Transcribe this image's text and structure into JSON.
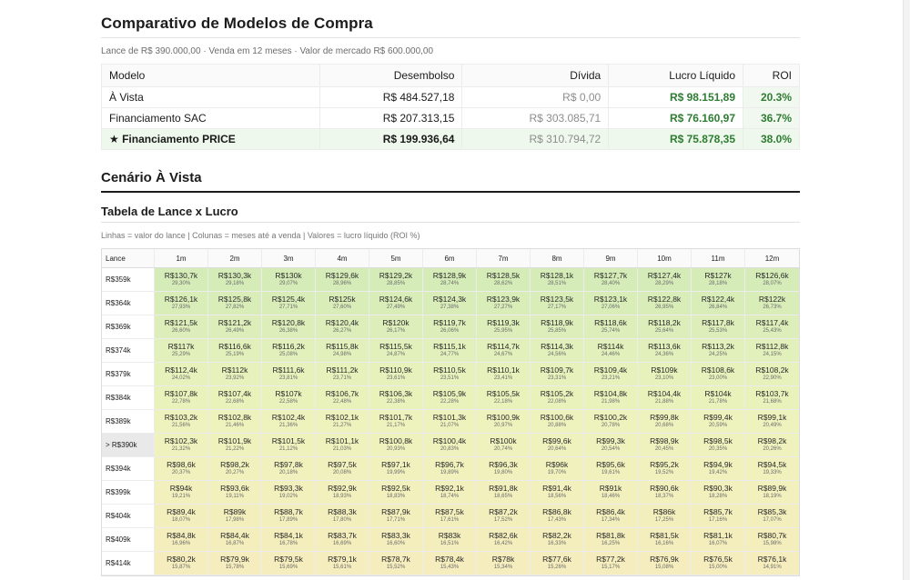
{
  "header": {
    "title": "Comparativo de Modelos de Compra",
    "subtitle": "Lance de R$ 390.000,00 · Venda em 12 meses · Valor de mercado R$ 600.000,00"
  },
  "comparison": {
    "columns": [
      "Modelo",
      "Desembolso",
      "Dívida",
      "Lucro Líquido",
      "ROI"
    ],
    "rows": [
      {
        "modelo": "À Vista",
        "desembolso": "R$ 484.527,18",
        "divida": "R$ 0,00",
        "lucro": "R$ 98.151,89",
        "roi": "20.3%"
      },
      {
        "modelo": "Financiamento SAC",
        "desembolso": "R$ 207.313,15",
        "divida": "R$ 303.085,71",
        "lucro": "R$ 76.160,97",
        "roi": "36.7%"
      },
      {
        "modelo": "★ Financiamento PRICE",
        "desembolso": "R$ 199.936,64",
        "divida": "R$ 310.794,72",
        "lucro": "R$ 75.878,35",
        "roi": "38.0%"
      }
    ]
  },
  "scenario": {
    "title": "Cenário À Vista",
    "table_title": "Tabela de Lance x Lucro",
    "legend": "Linhas = valor do lance | Colunas = meses até a venda | Valores = lucro líquido (ROI %)",
    "corner_label": "Lance",
    "months": [
      "1m",
      "2m",
      "3m",
      "4m",
      "5m",
      "6m",
      "7m",
      "8m",
      "9m",
      "10m",
      "11m",
      "12m"
    ],
    "colors": {
      "high": "#d5ecb8",
      "mid": "#eef3bd",
      "low": "#f5edbd"
    },
    "rows": [
      {
        "lance": "R$359k",
        "selected": false,
        "values": [
          "R$130,7k",
          "R$130,3k",
          "R$130k",
          "R$129,6k",
          "R$129,2k",
          "R$128,9k",
          "R$128,5k",
          "R$128,1k",
          "R$127,7k",
          "R$127,4k",
          "R$127k",
          "R$126,6k"
        ],
        "roi": [
          "29,30%",
          "29,18%",
          "29,07%",
          "28,96%",
          "28,85%",
          "28,74%",
          "28,62%",
          "28,51%",
          "28,40%",
          "28,29%",
          "28,18%",
          "28,07%"
        ]
      },
      {
        "lance": "R$364k",
        "selected": false,
        "values": [
          "R$126,1k",
          "R$125,8k",
          "R$125,4k",
          "R$125k",
          "R$124,6k",
          "R$124,3k",
          "R$123,9k",
          "R$123,5k",
          "R$123,1k",
          "R$122,8k",
          "R$122,4k",
          "R$122k"
        ],
        "roi": [
          "27,93%",
          "27,82%",
          "27,71%",
          "27,60%",
          "27,49%",
          "27,38%",
          "27,27%",
          "27,17%",
          "27,06%",
          "26,95%",
          "26,84%",
          "26,73%"
        ]
      },
      {
        "lance": "R$369k",
        "selected": false,
        "values": [
          "R$121,5k",
          "R$121,2k",
          "R$120,8k",
          "R$120,4k",
          "R$120k",
          "R$119,7k",
          "R$119,3k",
          "R$118,9k",
          "R$118,6k",
          "R$118,2k",
          "R$117,8k",
          "R$117,4k"
        ],
        "roi": [
          "26,60%",
          "26,49%",
          "26,38%",
          "26,27%",
          "26,17%",
          "26,06%",
          "25,95%",
          "25,85%",
          "25,74%",
          "25,64%",
          "25,53%",
          "25,43%"
        ]
      },
      {
        "lance": "R$374k",
        "selected": false,
        "values": [
          "R$117k",
          "R$116,6k",
          "R$116,2k",
          "R$115,8k",
          "R$115,5k",
          "R$115,1k",
          "R$114,7k",
          "R$114,3k",
          "R$114k",
          "R$113,6k",
          "R$113,2k",
          "R$112,8k"
        ],
        "roi": [
          "25,29%",
          "25,19%",
          "25,08%",
          "24,98%",
          "24,87%",
          "24,77%",
          "24,67%",
          "24,56%",
          "24,46%",
          "24,36%",
          "24,25%",
          "24,15%"
        ]
      },
      {
        "lance": "R$379k",
        "selected": false,
        "values": [
          "R$112,4k",
          "R$112k",
          "R$111,6k",
          "R$111,2k",
          "R$110,9k",
          "R$110,5k",
          "R$110,1k",
          "R$109,7k",
          "R$109,4k",
          "R$109k",
          "R$108,6k",
          "R$108,2k"
        ],
        "roi": [
          "24,02%",
          "23,92%",
          "23,81%",
          "23,71%",
          "23,61%",
          "23,51%",
          "23,41%",
          "23,31%",
          "23,21%",
          "23,10%",
          "23,00%",
          "22,90%"
        ]
      },
      {
        "lance": "R$384k",
        "selected": false,
        "values": [
          "R$107,8k",
          "R$107,4k",
          "R$107k",
          "R$106,7k",
          "R$106,3k",
          "R$105,9k",
          "R$105,5k",
          "R$105,2k",
          "R$104,8k",
          "R$104,4k",
          "R$104k",
          "R$103,7k"
        ],
        "roi": [
          "22,78%",
          "22,68%",
          "22,58%",
          "22,48%",
          "22,38%",
          "22,28%",
          "22,18%",
          "22,08%",
          "21,98%",
          "21,88%",
          "21,78%",
          "21,68%"
        ]
      },
      {
        "lance": "R$389k",
        "selected": false,
        "values": [
          "R$103,2k",
          "R$102,8k",
          "R$102,4k",
          "R$102,1k",
          "R$101,7k",
          "R$101,3k",
          "R$100,9k",
          "R$100,6k",
          "R$100,2k",
          "R$99,8k",
          "R$99,4k",
          "R$99,1k"
        ],
        "roi": [
          "21,56%",
          "21,46%",
          "21,36%",
          "21,27%",
          "21,17%",
          "21,07%",
          "20,97%",
          "20,88%",
          "20,78%",
          "20,68%",
          "20,59%",
          "20,49%"
        ]
      },
      {
        "lance": "> R$390k",
        "selected": true,
        "values": [
          "R$102,3k",
          "R$101,9k",
          "R$101,5k",
          "R$101,1k",
          "R$100,8k",
          "R$100,4k",
          "R$100k",
          "R$99,6k",
          "R$99,3k",
          "R$98,9k",
          "R$98,5k",
          "R$98,2k"
        ],
        "roi": [
          "21,32%",
          "21,22%",
          "21,12%",
          "21,03%",
          "20,93%",
          "20,83%",
          "20,74%",
          "20,64%",
          "20,54%",
          "20,45%",
          "20,35%",
          "20,26%"
        ]
      },
      {
        "lance": "R$394k",
        "selected": false,
        "values": [
          "R$98,6k",
          "R$98,2k",
          "R$97,8k",
          "R$97,5k",
          "R$97,1k",
          "R$96,7k",
          "R$96,3k",
          "R$96k",
          "R$95,6k",
          "R$95,2k",
          "R$94,9k",
          "R$94,5k"
        ],
        "roi": [
          "20,37%",
          "20,27%",
          "20,18%",
          "20,08%",
          "19,99%",
          "19,89%",
          "19,80%",
          "19,70%",
          "19,61%",
          "19,52%",
          "19,42%",
          "19,33%"
        ]
      },
      {
        "lance": "R$399k",
        "selected": false,
        "values": [
          "R$94k",
          "R$93,6k",
          "R$93,3k",
          "R$92,9k",
          "R$92,5k",
          "R$92,1k",
          "R$91,8k",
          "R$91,4k",
          "R$91k",
          "R$90,6k",
          "R$90,3k",
          "R$89,9k"
        ],
        "roi": [
          "19,21%",
          "19,11%",
          "19,02%",
          "18,93%",
          "18,83%",
          "18,74%",
          "18,65%",
          "18,56%",
          "18,46%",
          "18,37%",
          "18,28%",
          "18,19%"
        ]
      },
      {
        "lance": "R$404k",
        "selected": false,
        "values": [
          "R$89,4k",
          "R$89k",
          "R$88,7k",
          "R$88,3k",
          "R$87,9k",
          "R$87,5k",
          "R$87,2k",
          "R$86,8k",
          "R$86,4k",
          "R$86k",
          "R$85,7k",
          "R$85,3k"
        ],
        "roi": [
          "18,07%",
          "17,98%",
          "17,89%",
          "17,80%",
          "17,71%",
          "17,61%",
          "17,52%",
          "17,43%",
          "17,34%",
          "17,25%",
          "17,16%",
          "17,07%"
        ]
      },
      {
        "lance": "R$409k",
        "selected": false,
        "values": [
          "R$84,8k",
          "R$84,4k",
          "R$84,1k",
          "R$83,7k",
          "R$83,3k",
          "R$83k",
          "R$82,6k",
          "R$82,2k",
          "R$81,8k",
          "R$81,5k",
          "R$81,1k",
          "R$80,7k"
        ],
        "roi": [
          "16,96%",
          "16,87%",
          "16,78%",
          "16,69%",
          "16,60%",
          "16,51%",
          "16,42%",
          "16,33%",
          "16,25%",
          "16,16%",
          "16,07%",
          "15,98%"
        ]
      },
      {
        "lance": "R$414k",
        "selected": false,
        "values": [
          "R$80,2k",
          "R$79,9k",
          "R$79,5k",
          "R$79,1k",
          "R$78,7k",
          "R$78,4k",
          "R$78k",
          "R$77,6k",
          "R$77,2k",
          "R$76,9k",
          "R$76,5k",
          "R$76,1k"
        ],
        "roi": [
          "15,87%",
          "15,78%",
          "15,69%",
          "15,61%",
          "15,52%",
          "15,43%",
          "15,34%",
          "15,26%",
          "15,17%",
          "15,08%",
          "15,00%",
          "14,91%"
        ]
      }
    ]
  }
}
